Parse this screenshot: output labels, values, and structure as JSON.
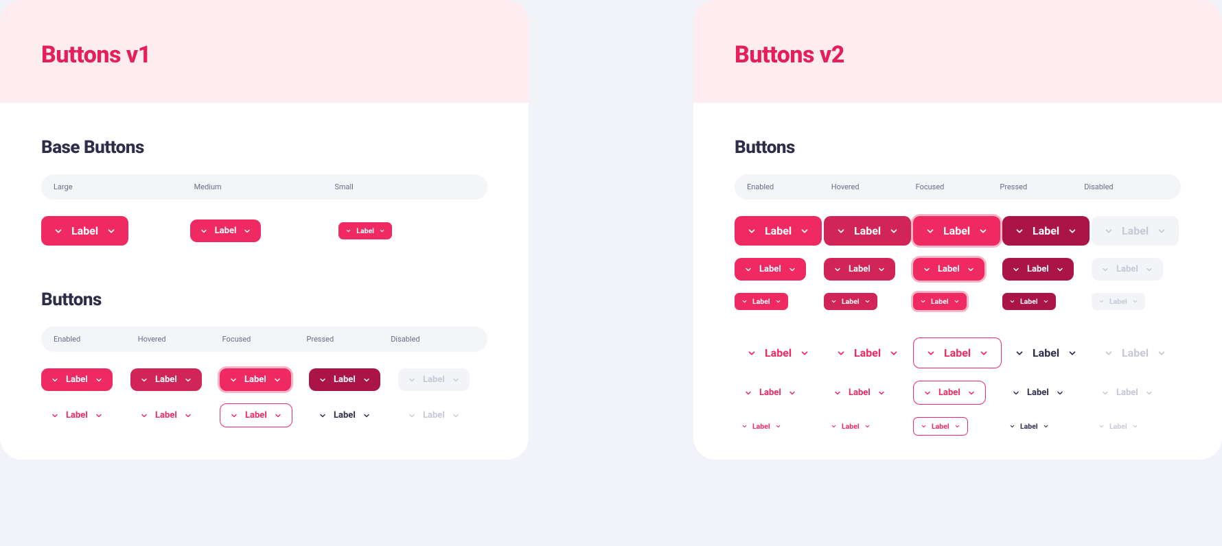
{
  "panels": {
    "v1": {
      "title": "Buttons v1"
    },
    "v2": {
      "title": "Buttons v2"
    }
  },
  "sections": {
    "base": "Base Buttons",
    "buttons": "Buttons"
  },
  "sizeCols": {
    "lg": "Large",
    "md": "Medium",
    "sm": "Small"
  },
  "stateCols": {
    "enabled": "Enabled",
    "hovered": "Hovered",
    "focused": "Focused",
    "pressed": "Pressed",
    "disabled": "Disabled"
  },
  "label": "Label",
  "colors": {
    "brand": "#e61e5a",
    "filledEnabled": "#ef2a62",
    "filledHovered": "#d12457",
    "filledPressed": "#aa1446",
    "disabledBg": "#f3f4f8",
    "disabledFg": "#c6c8d4",
    "textPressed": "#2c2d4a"
  }
}
